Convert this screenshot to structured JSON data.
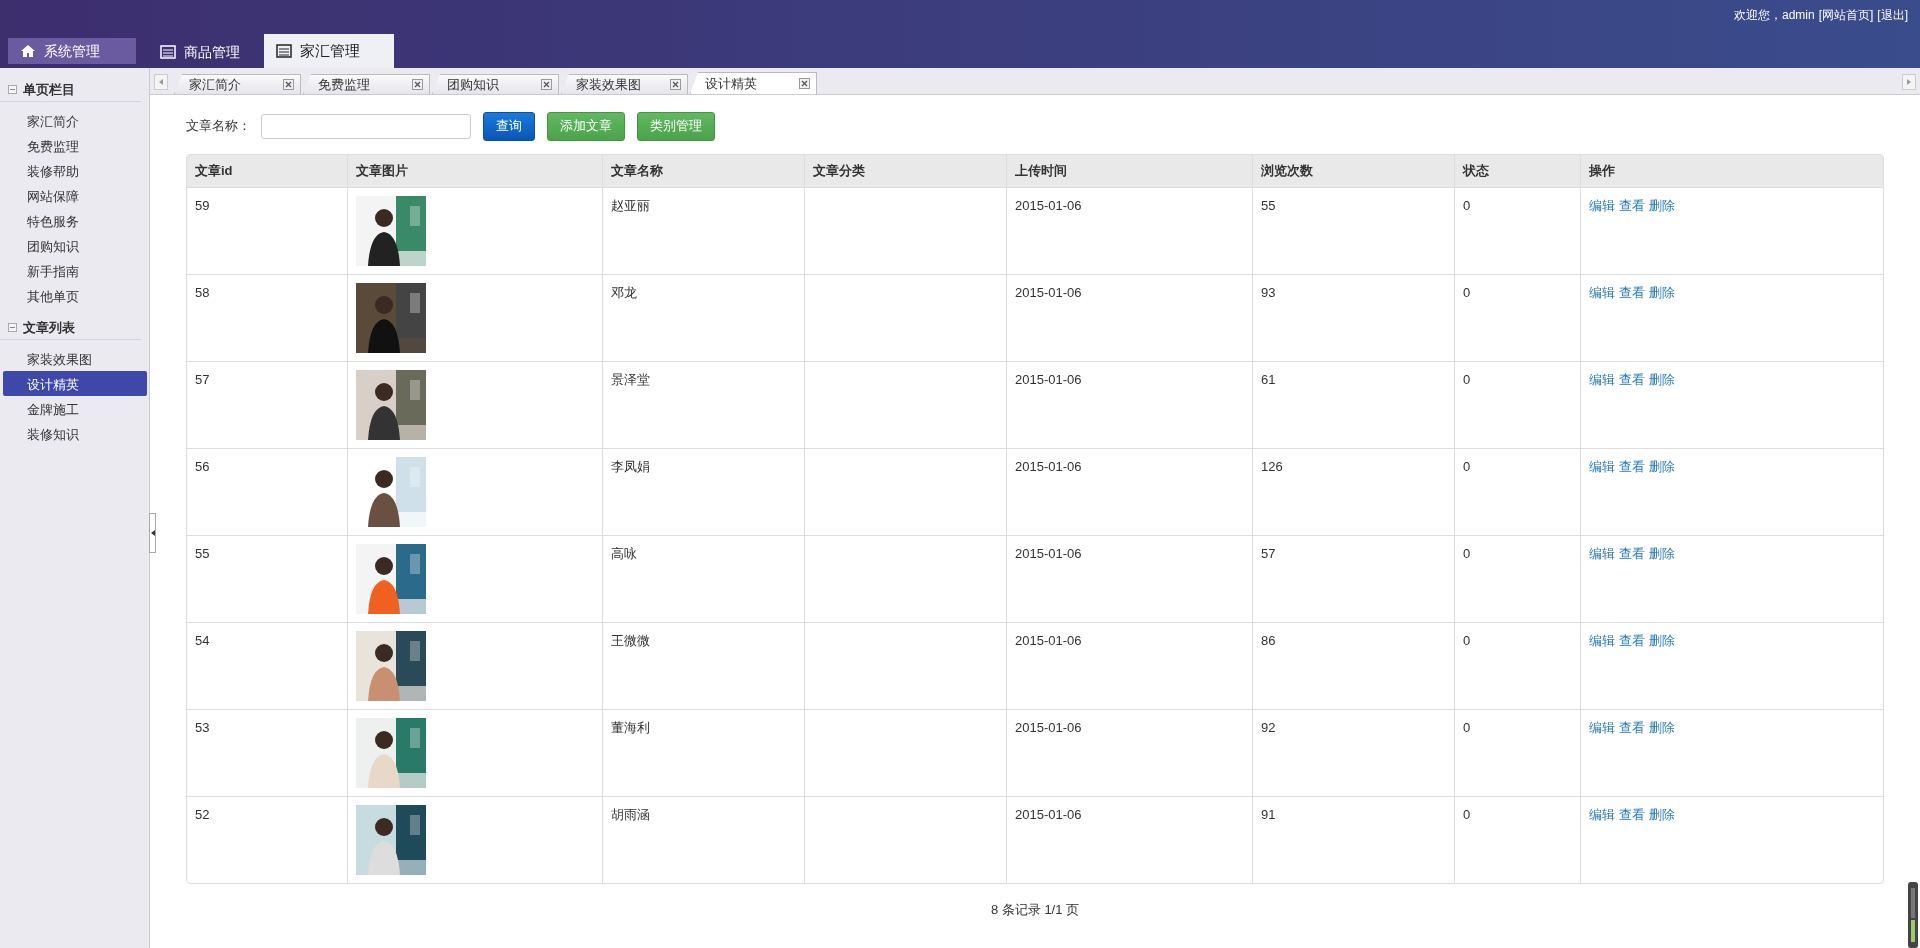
{
  "header": {
    "welcome": "欢迎您，admin",
    "links": [
      "[网站首页]",
      "[退出]"
    ]
  },
  "main_tabs": [
    {
      "label": "系统管理",
      "kind": "home",
      "selected": false,
      "highlighted": true
    },
    {
      "label": "商品管理",
      "kind": "list",
      "selected": false,
      "highlighted": false
    },
    {
      "label": "家汇管理",
      "kind": "list",
      "selected": true,
      "highlighted": false
    }
  ],
  "sidebar": {
    "groups": [
      {
        "title": "单页栏目",
        "items": [
          {
            "label": "家汇简介",
            "selected": false
          },
          {
            "label": "免费监理",
            "selected": false
          },
          {
            "label": "装修帮助",
            "selected": false
          },
          {
            "label": "网站保障",
            "selected": false
          },
          {
            "label": "特色服务",
            "selected": false
          },
          {
            "label": "团购知识",
            "selected": false
          },
          {
            "label": "新手指南",
            "selected": false
          },
          {
            "label": "其他单页",
            "selected": false
          }
        ]
      },
      {
        "title": "文章列表",
        "items": [
          {
            "label": "家装效果图",
            "selected": false
          },
          {
            "label": "设计精英",
            "selected": true
          },
          {
            "label": "金牌施工",
            "selected": false
          },
          {
            "label": "装修知识",
            "selected": false
          }
        ]
      }
    ]
  },
  "page_tabs": [
    {
      "label": "家汇简介",
      "selected": false
    },
    {
      "label": "免费监理",
      "selected": false
    },
    {
      "label": "团购知识",
      "selected": false
    },
    {
      "label": "家装效果图",
      "selected": false
    },
    {
      "label": "设计精英",
      "selected": true
    }
  ],
  "search": {
    "label": "文章名称：",
    "buttons": [
      {
        "label": "查询",
        "kind": "primary"
      },
      {
        "label": "添加文章",
        "kind": "success"
      },
      {
        "label": "类别管理",
        "kind": "success"
      }
    ]
  },
  "table": {
    "columns": [
      "文章id",
      "文章图片",
      "文章名称",
      "文章分类",
      "上传时间",
      "浏览次数",
      "状态",
      "操作"
    ],
    "rows": [
      {
        "id": "59",
        "name": "赵亚丽",
        "date": "2015-01-06",
        "views": "55",
        "status": "0",
        "actions": [
          "编辑",
          "查看",
          "删除"
        ]
      },
      {
        "id": "58",
        "name": "邓龙",
        "date": "2015-01-06",
        "views": "93",
        "status": "0",
        "actions": [
          "编辑",
          "查看",
          "删除"
        ]
      },
      {
        "id": "57",
        "name": "景泽堂",
        "date": "2015-01-06",
        "views": "61",
        "status": "0",
        "actions": [
          "编辑",
          "查看",
          "删除"
        ]
      },
      {
        "id": "56",
        "name": "李凤娟",
        "date": "2015-01-06",
        "views": "126",
        "status": "0",
        "actions": [
          "编辑",
          "查看",
          "删除"
        ]
      },
      {
        "id": "55",
        "name": "高咏",
        "date": "2015-01-06",
        "views": "57",
        "status": "0",
        "actions": [
          "编辑",
          "查看",
          "删除"
        ]
      },
      {
        "id": "54",
        "name": "王微微",
        "date": "2015-01-06",
        "views": "86",
        "status": "0",
        "actions": [
          "编辑",
          "查看",
          "删除"
        ]
      },
      {
        "id": "53",
        "name": "董海利",
        "date": "2015-01-06",
        "views": "92",
        "status": "0",
        "actions": [
          "编辑",
          "查看",
          "删除"
        ]
      },
      {
        "id": "52",
        "name": "胡雨涵",
        "date": "2015-01-06",
        "views": "91",
        "status": "0",
        "actions": [
          "编辑",
          "查看",
          "删除"
        ]
      }
    ]
  },
  "pagination": "8 条记录 1/1 页"
}
